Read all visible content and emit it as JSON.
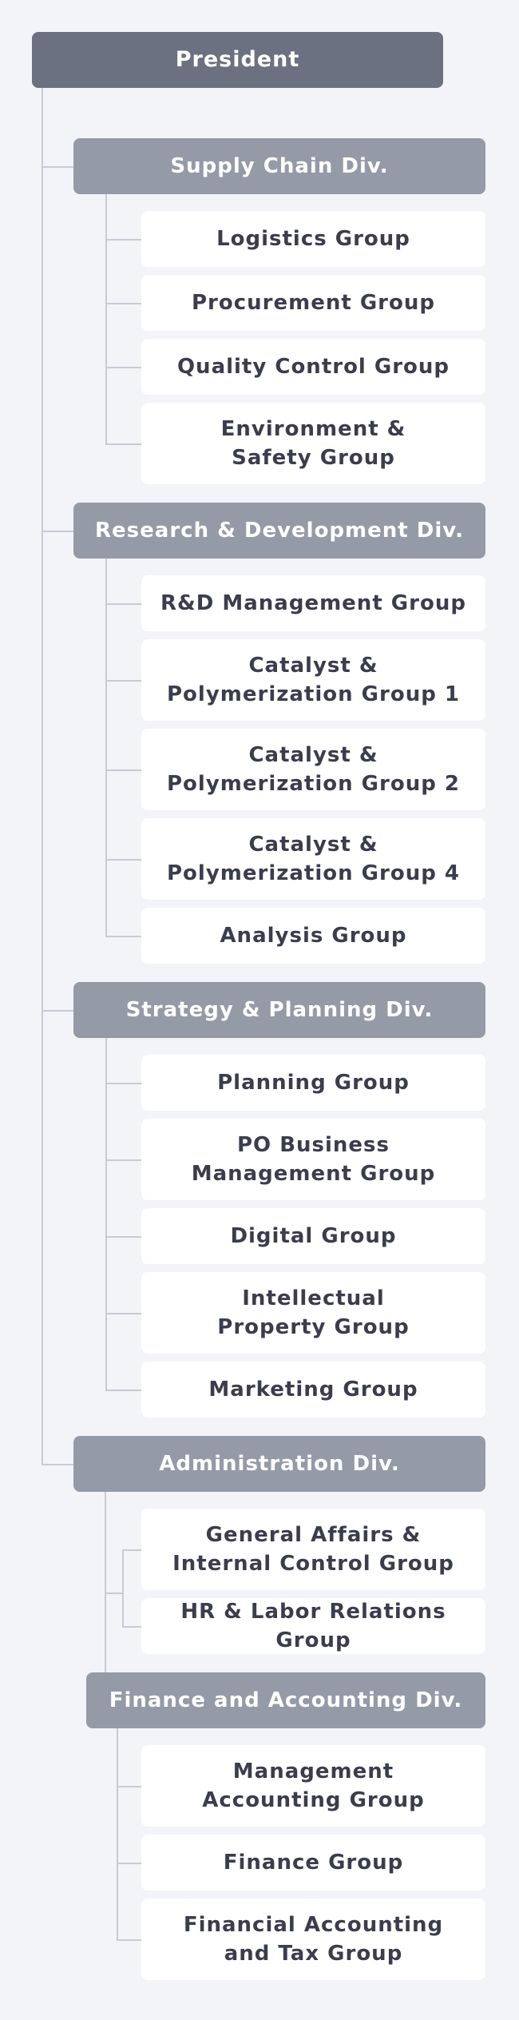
{
  "colors": {
    "background": "#f2f4f8",
    "president": "#6b7181",
    "division": "#959aa7",
    "group_bg": "#ffffff",
    "text": "#3a3d4d",
    "connector": "#c8cad6"
  },
  "president": "President",
  "divisions": [
    {
      "name": "Supply Chain Div.",
      "groups": [
        "Logistics Group",
        "Procurement Group",
        "Quality Control Group",
        "Environment &\nSafety Group"
      ]
    },
    {
      "name": "Research & Development Div.",
      "groups": [
        "R&D Management Group",
        "Catalyst &\nPolymerization Group 1",
        "Catalyst &\nPolymerization Group 2",
        "Catalyst &\nPolymerization Group  4",
        "Analysis Group"
      ]
    },
    {
      "name": "Strategy & Planning Div.",
      "groups": [
        "Planning Group",
        "PO Business\nManagement Group",
        "Digital Group",
        "Intellectual\nProperty Group",
        "Marketing Group"
      ]
    },
    {
      "name": "Administration Div.",
      "groups": [
        "General Affairs &\nInternal Control Group",
        "HR & Labor Relations Group"
      ]
    },
    {
      "name": "Finance and Accounting Div.",
      "groups": [
        "Management\nAccounting Group",
        "Finance Group",
        "Financial Accounting\nand Tax Group"
      ]
    }
  ]
}
